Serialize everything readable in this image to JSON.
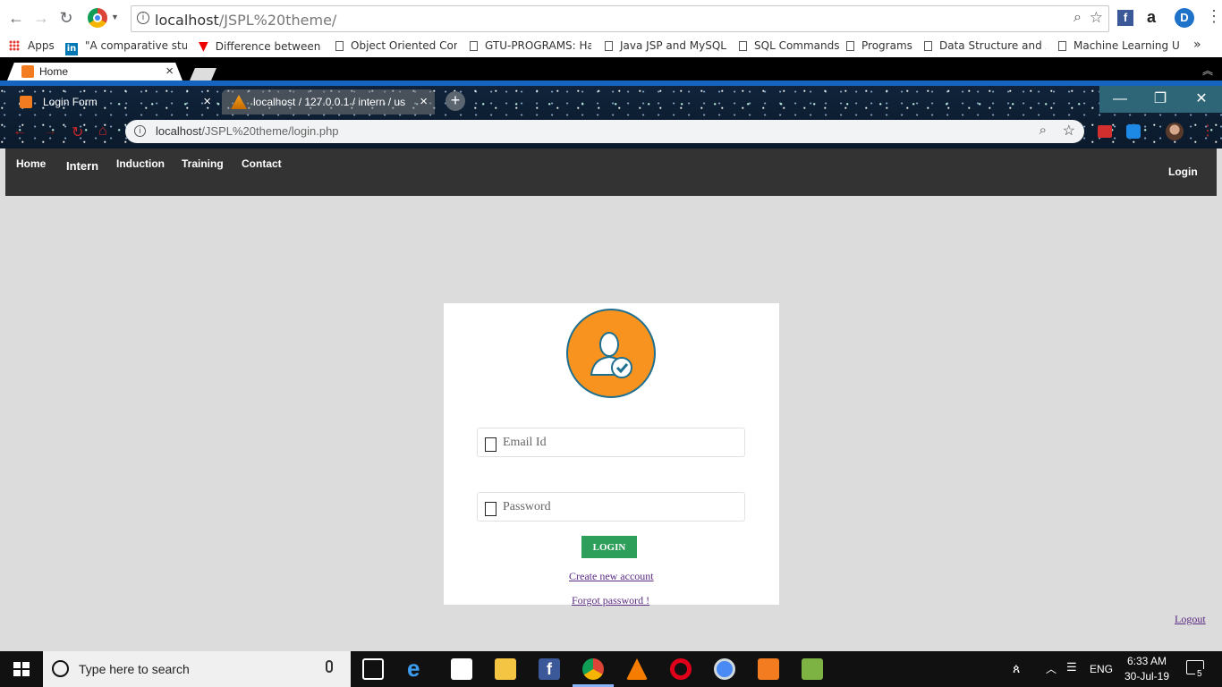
{
  "outer_browser": {
    "url_host": "localhost",
    "url_path": "/JSPL%20theme/",
    "bookmarks": [
      {
        "label": "Apps"
      },
      {
        "label": "\"A comparative study"
      },
      {
        "label": "Difference between t"
      },
      {
        "label": "Object Oriented Conc"
      },
      {
        "label": "GTU-PROGRAMS: Ha"
      },
      {
        "label": "Java JSP and MySQL"
      },
      {
        "label": "SQL Commands"
      },
      {
        "label": "Programs"
      },
      {
        "label": "Data Structure and Al"
      },
      {
        "label": "Machine Learning Us"
      }
    ],
    "more_bookmarks": "»",
    "tab_title": "Home",
    "tab_close": "×"
  },
  "inner_browser": {
    "tabs": [
      {
        "title": "Login Form",
        "close": "×"
      },
      {
        "title": "localhost / 127.0.0.1 / intern / us",
        "close": "×"
      }
    ],
    "new_tab": "+",
    "url_host": "localhost",
    "url_path": "/JSPL%20theme/login.php",
    "window_controls": {
      "minimize": "—",
      "maximize": "❐",
      "close": "✕"
    }
  },
  "site_nav": {
    "items": [
      "Home",
      "Intern",
      "Induction",
      "Training",
      "Contact"
    ],
    "login": "Login"
  },
  "login_form": {
    "email_placeholder": "Email Id",
    "password_placeholder": "Password",
    "login_button": "LOGIN",
    "create_account": "Create new account",
    "forgot_password": "Forgot password !"
  },
  "logout_link": "Logout",
  "taskbar": {
    "search_placeholder": "Type here to search",
    "language": "ENG",
    "time": "6:33 AM",
    "date": "30-Jul-19",
    "notification_count": "5"
  },
  "colors": {
    "accent_blue": "#1565c0",
    "nav_bg": "#333333",
    "avatar_orange": "#f7931e",
    "login_green": "#2e9e5b"
  }
}
